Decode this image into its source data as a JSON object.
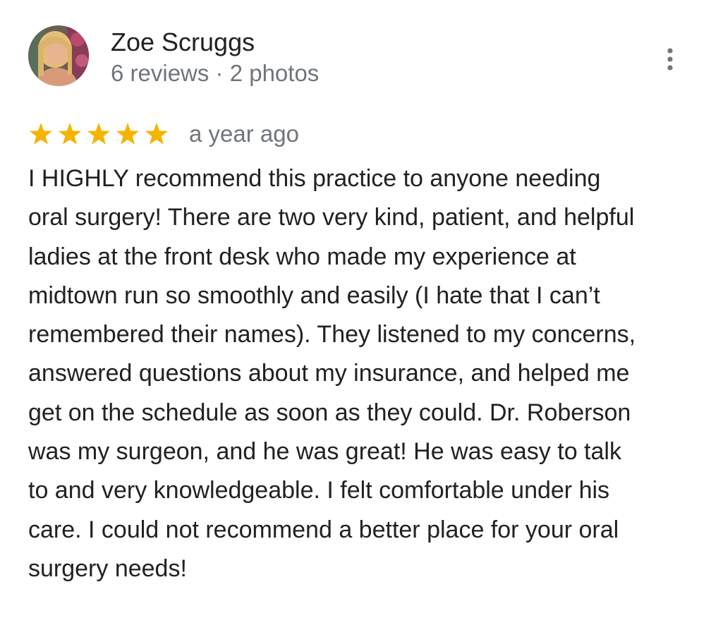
{
  "reviewer": {
    "name": "Zoe Scruggs",
    "meta": "6 reviews · 2 photos",
    "avatar_icon": "profile-photo"
  },
  "review": {
    "rating": 5,
    "rating_max": 5,
    "star_color": "#f4b400",
    "date": "a year ago",
    "text": "I HIGHLY recommend this practice to anyone needing\noral surgery! There are two very kind, patient, and helpful\nladies at the front desk who made my experience at\nmidtown run so smoothly and easily (I hate that I can’t\nremembered their names). They listened to my concerns,\nanswered questions about my insurance, and helped me\nget on the schedule as soon as they could. Dr. Roberson\nwas my surgeon, and he was great! He was easy to talk\nto and very knowledgeable. I felt comfortable under his\ncare. I could not recommend a better place for your oral\nsurgery needs!"
  },
  "actions": {
    "more_icon": "more-vert-icon"
  }
}
